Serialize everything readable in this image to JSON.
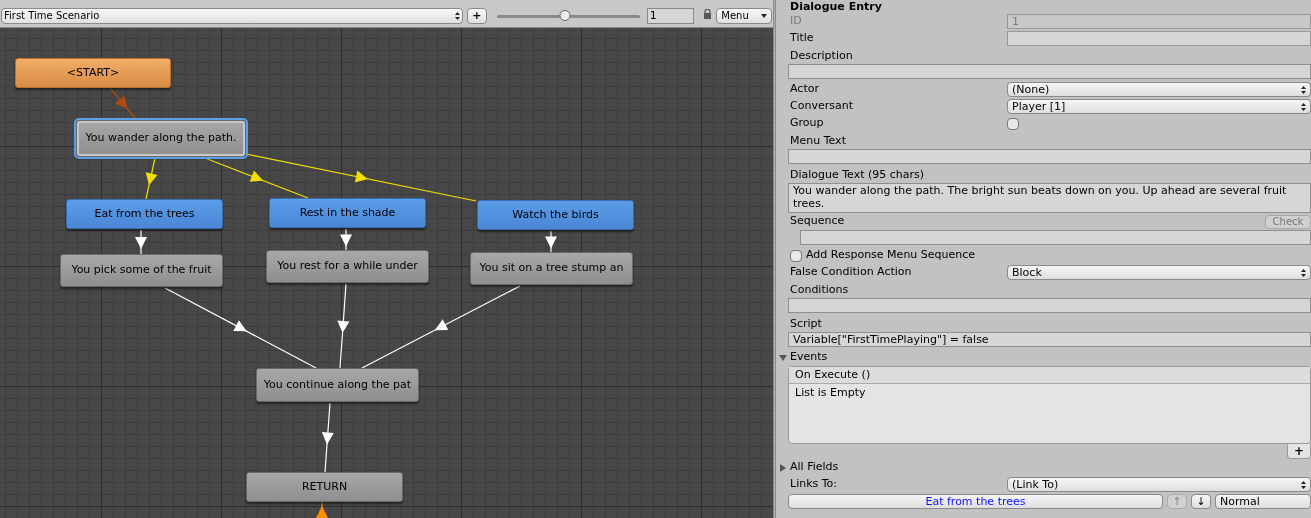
{
  "toolbar": {
    "conversation": "First Time Scenario",
    "add_button": "+",
    "zoom": {
      "level": 0.48
    },
    "zoom_value": "1",
    "menu": "Menu"
  },
  "nodes": [
    {
      "kind": "start",
      "text": "<START>",
      "selected": false
    },
    {
      "kind": "dialogue",
      "text": "You wander along the path.",
      "selected": true
    },
    {
      "kind": "response",
      "text": "Eat from the trees",
      "selected": false
    },
    {
      "kind": "response",
      "text": "Rest in the shade",
      "selected": false
    },
    {
      "kind": "response",
      "text": "Watch the birds",
      "selected": false
    },
    {
      "kind": "dialogue",
      "text": "You pick some of the fruit",
      "selected": false
    },
    {
      "kind": "dialogue",
      "text": "You rest for a while under",
      "selected": false
    },
    {
      "kind": "dialogue",
      "text": "You sit on a tree stump an",
      "selected": false
    },
    {
      "kind": "dialogue",
      "text": "You continue along the pat",
      "selected": false
    },
    {
      "kind": "dialogue",
      "text": "RETURN",
      "selected": false
    }
  ],
  "inspector": {
    "title": "Dialogue Entry",
    "fields": [
      {
        "kind": "inline",
        "label": "ID",
        "value": "1",
        "disabled": true
      },
      {
        "kind": "inline",
        "label": "Title",
        "disabled": false
      },
      {
        "kind": "block",
        "label": "Description"
      },
      {
        "kind": "dropdown",
        "label": "Actor",
        "value": "(None)"
      },
      {
        "kind": "dropdown",
        "label": "Conversant",
        "value": "Player [1]"
      },
      {
        "kind": "checkbox",
        "label": "Group",
        "checked": false
      },
      {
        "kind": "block",
        "label": "Menu Text"
      },
      {
        "kind": "textarea",
        "label": "Dialogue Text (95 chars)",
        "value": "You wander along the path. The bright sun beats down on you. Up ahead are several fruit trees."
      },
      {
        "kind": "sequence",
        "label": "Sequence",
        "button": "Check"
      },
      {
        "kind": "checkbox_left",
        "label": "Add Response Menu Sequence",
        "checked": false
      },
      {
        "kind": "dropdown",
        "label": "False Condition Action",
        "value": "Block"
      },
      {
        "kind": "block",
        "label": "Conditions"
      },
      {
        "kind": "block",
        "label": "Script",
        "value": "Variable[\"FirstTimePlaying\"] = false"
      },
      {
        "kind": "foldout",
        "label": "Events",
        "expanded": true,
        "event": "On Execute ()",
        "empty": "List is Empty",
        "add": "+"
      },
      {
        "kind": "foldout",
        "label": "All Fields",
        "expanded": false
      },
      {
        "kind": "dropdown",
        "label": "Links To:",
        "value": "(Link To)"
      },
      {
        "kind": "link",
        "value": "Eat from the trees",
        "up": "↑",
        "down": "↓",
        "priority": "Normal"
      }
    ]
  }
}
